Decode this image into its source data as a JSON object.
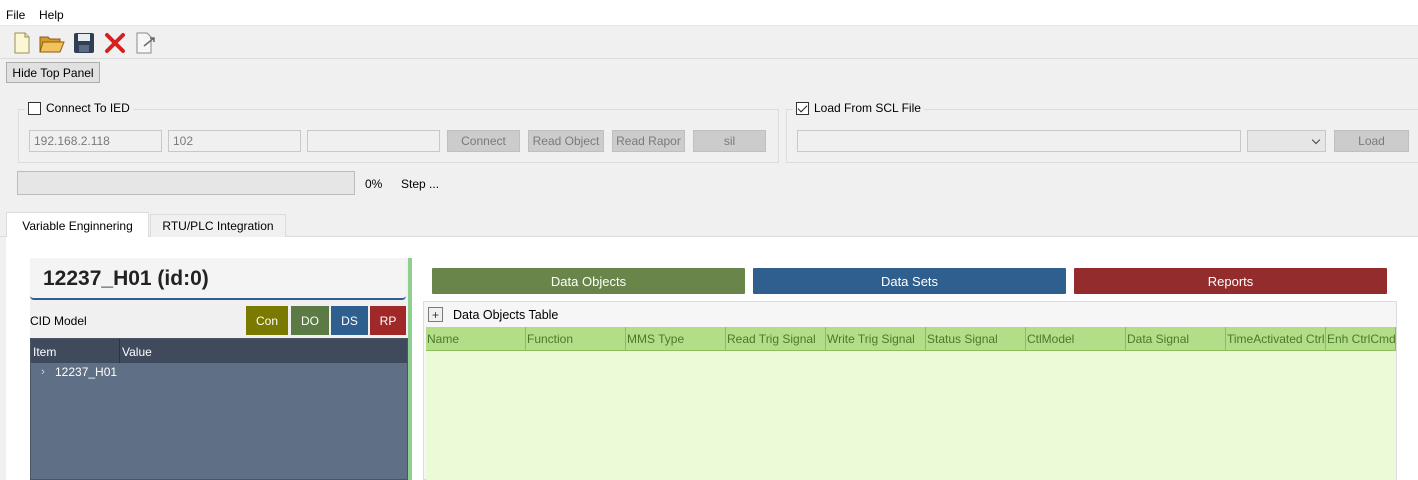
{
  "menu": {
    "file": "File",
    "help": "Help"
  },
  "toolbar": {
    "icons": [
      "new-file-icon",
      "open-folder-icon",
      "save-icon",
      "delete-icon",
      "export-icon"
    ]
  },
  "top": {
    "hide_panel": "Hide Top Panel"
  },
  "connect": {
    "title": "Connect To IED",
    "checked": false,
    "ip": "192.168.2.118",
    "port": "102",
    "extra": "",
    "connect_btn": "Connect",
    "read_object_btn": "Read Object",
    "read_rapor_btn": "Read Rapor",
    "sil_btn": "sil"
  },
  "scl": {
    "title": "Load From SCL File",
    "checked": true,
    "path": "",
    "load_btn": "Load"
  },
  "progress": {
    "percent_text": "0%",
    "step": "Step ...",
    "value": 0
  },
  "tabs": [
    {
      "label": "Variable Enginnering"
    },
    {
      "label": "RTU/PLC Integration"
    }
  ],
  "model": {
    "header": "12237_H01 (id:0)",
    "cid_label": "CID Model",
    "buttons": [
      {
        "label": "Con",
        "color": "#7a7a00"
      },
      {
        "label": "DO",
        "color": "#5b7a44"
      },
      {
        "label": "DS",
        "color": "#2e5f8e"
      },
      {
        "label": "RP",
        "color": "#a02828"
      }
    ],
    "tree_headers": [
      "Item",
      "Value"
    ],
    "tree_rows": [
      {
        "label": "12237_H01"
      }
    ]
  },
  "main_buttons": [
    {
      "label": "Data Objects",
      "color": "#6a8549"
    },
    {
      "label": "Data Sets",
      "color": "#2e5f8e"
    },
    {
      "label": "Reports",
      "color": "#932d2d"
    }
  ],
  "data_objects": {
    "title": "Data Objects Table",
    "columns": [
      "Name",
      "Function",
      "MMS Type",
      "Read Trig Signal",
      "Write Trig Signal",
      "Status Signal",
      "CtlModel",
      "Data Signal",
      "TimeActivated Ctrl",
      "Enh CtrlCmd"
    ]
  }
}
